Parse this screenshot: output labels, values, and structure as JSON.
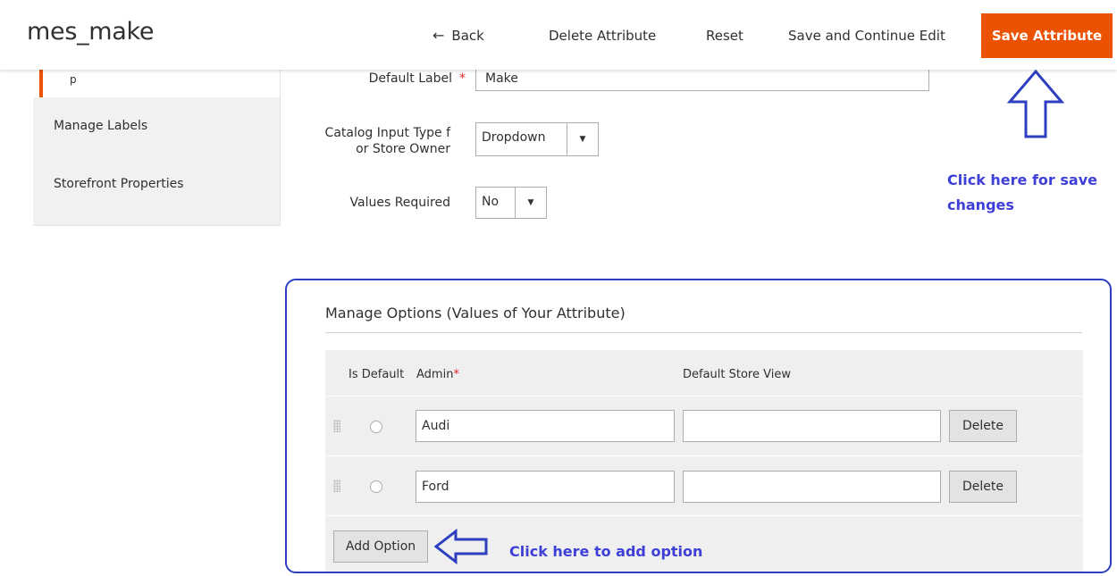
{
  "header": {
    "title": "mes_make",
    "back_arrow": "←",
    "back_label": "Back",
    "delete_label": "Delete Attribute",
    "reset_label": "Reset",
    "save_continue_label": "Save and Continue Edit",
    "save_label": "Save Attribute",
    "accent_color": "#eb5202"
  },
  "tabs": {
    "properties_fragment": "p",
    "items": [
      "Manage Labels",
      "Storefront Properties"
    ]
  },
  "form": {
    "default_label": {
      "label": "Default Label",
      "required_mark": "*",
      "value": "Make"
    },
    "catalog_input": {
      "label": "Catalog Input Type f or Store Owner",
      "value": "Dropdown",
      "arrow": "▼"
    },
    "values_required": {
      "label": "Values Required",
      "value": "No",
      "arrow": "▼"
    }
  },
  "annotations": {
    "save_hint": "Click here for save changes",
    "add_hint": "Click here to add option",
    "color": "#3d3fd6"
  },
  "options": {
    "title": "Manage Options (Values of Your Attribute)",
    "headers": {
      "is_default": "Is Default",
      "admin": "Admin",
      "admin_required": "*",
      "store_view": "Default Store View"
    },
    "rows": [
      {
        "admin": "Audi",
        "store_view": "",
        "delete_label": "Delete"
      },
      {
        "admin": "Ford",
        "store_view": "",
        "delete_label": "Delete"
      }
    ],
    "add_label": "Add Option"
  }
}
